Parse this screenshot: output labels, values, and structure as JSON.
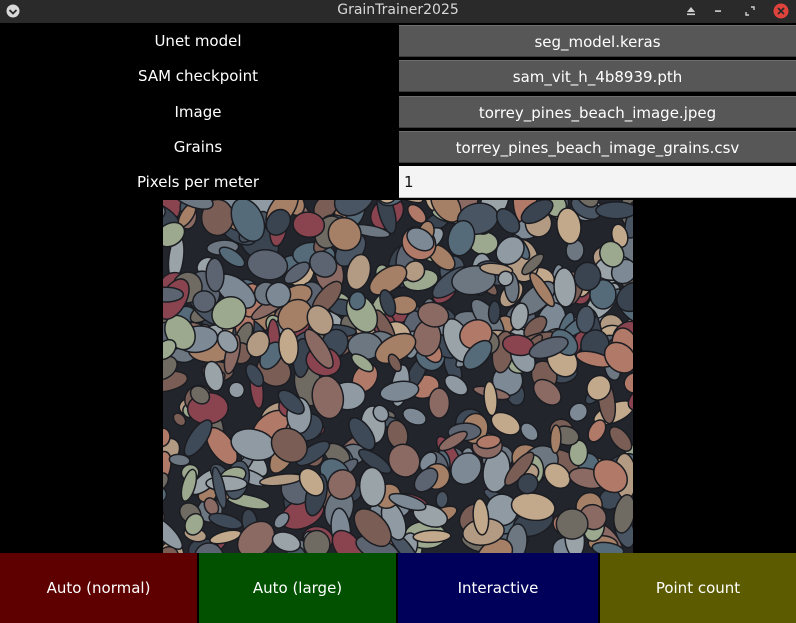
{
  "window": {
    "title": "GrainTrainer2025"
  },
  "form": {
    "rows": [
      {
        "label": "Unet model",
        "value": "seg_model.keras"
      },
      {
        "label": "SAM checkpoint",
        "value": "sam_vit_h_4b8939.pth"
      },
      {
        "label": "Image",
        "value": "torrey_pines_beach_image.jpeg"
      },
      {
        "label": "Grains",
        "value": "torrey_pines_beach_image_grains.csv"
      }
    ],
    "scale": {
      "label": "Pixels per meter",
      "value": "1"
    }
  },
  "actions": {
    "auto_normal": "Auto (normal)",
    "auto_large": "Auto (large)",
    "interactive": "Interactive",
    "point_count": "Point count"
  },
  "colors": {
    "auto_normal": "#5e0000",
    "auto_large": "#015100",
    "interactive": "#00005a",
    "point_count": "#5c5b00"
  }
}
